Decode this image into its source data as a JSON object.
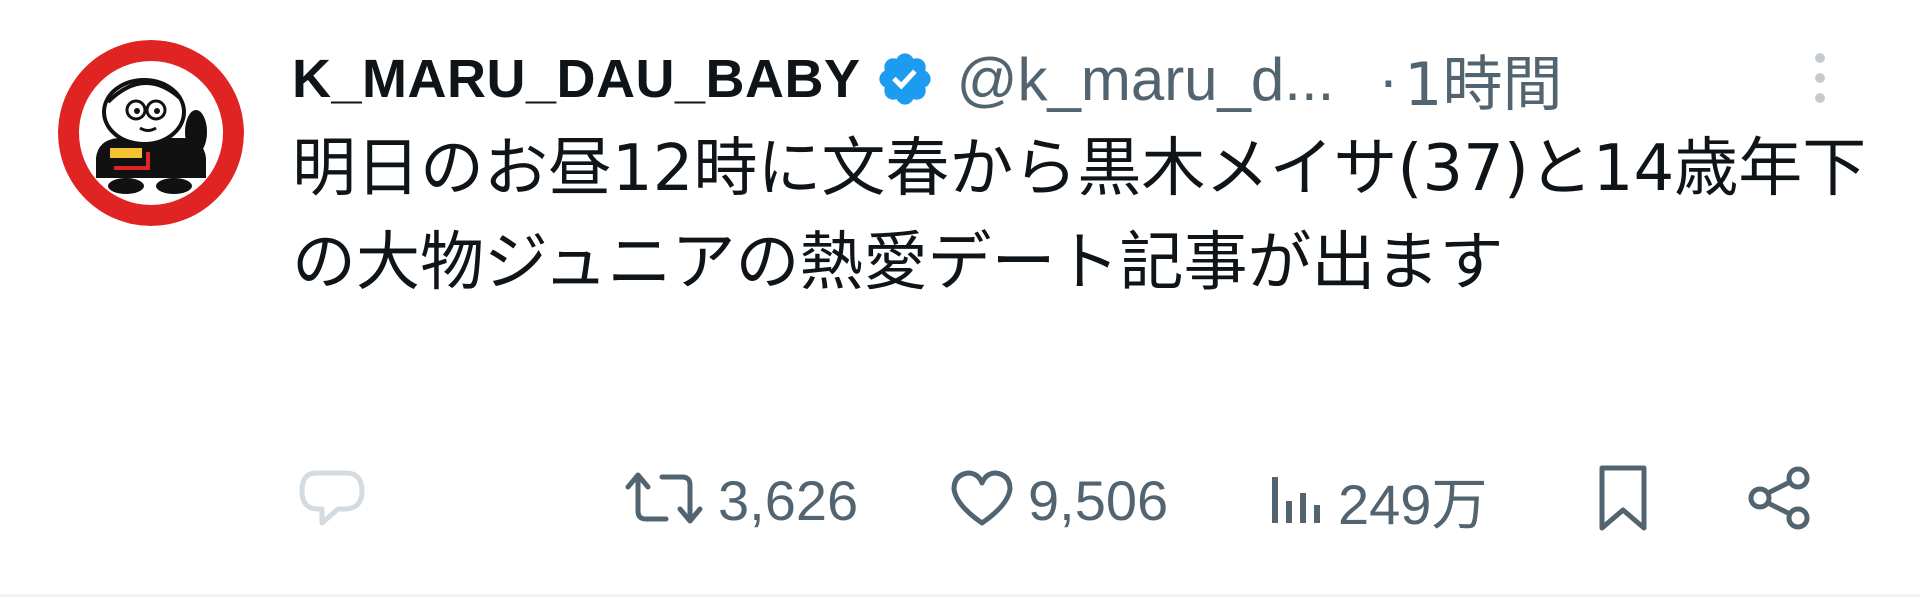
{
  "tweet": {
    "display_name": "K_MARU_DAU_BABY",
    "handle": "@k_maru_d...",
    "separator": "·",
    "time": "1時間",
    "text": "明日のお昼12時に文春から黒木メイサ(37)と14歳年下の大物ジュニアの熱愛デート記事が出ます"
  },
  "actions": {
    "retweets": "3,626",
    "likes": "9,506",
    "views": "249万"
  },
  "colors": {
    "text_primary": "#0f1419",
    "text_secondary": "#536471",
    "verified_blue": "#1d9bf0",
    "avatar_red": "#e02424",
    "divider": "#eff3f4"
  },
  "icons": [
    "avatar",
    "verified-badge-icon",
    "more-icon",
    "reply-icon",
    "retweet-icon",
    "like-icon",
    "views-icon",
    "bookmark-icon",
    "share-icon"
  ]
}
